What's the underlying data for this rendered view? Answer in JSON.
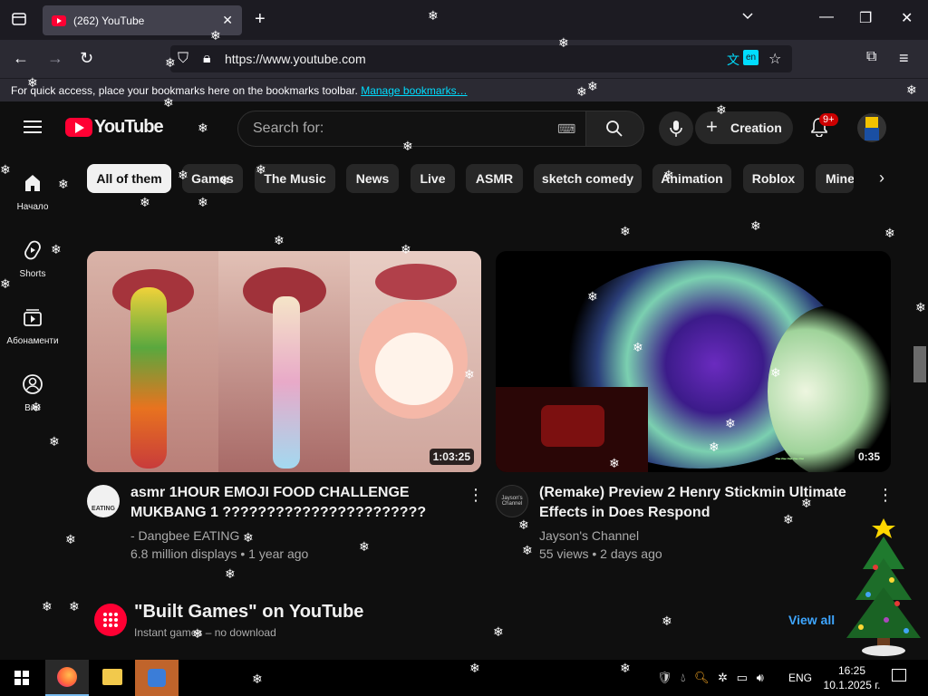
{
  "browser": {
    "tab_title": "(262) YouTube",
    "url": "https://www.youtube.com",
    "bookmarks_hint": "For quick access, place your bookmarks here on the bookmarks toolbar.",
    "bookmarks_link": "Manage bookmarks…",
    "translate_badge": "en"
  },
  "youtube": {
    "logo": "YouTube",
    "search_placeholder": "Search for:",
    "create_label": "Creation",
    "notif_count": "9+",
    "chips": [
      "All of them",
      "Games",
      "The Music",
      "News",
      "Live",
      "ASMR",
      "sketch comedy",
      "Animation",
      "Roblox",
      "Mine"
    ],
    "sidebar": [
      {
        "label": "Начало",
        "icon": "home-icon"
      },
      {
        "label": "Shorts",
        "icon": "shorts-icon"
      },
      {
        "label": "Абонаменти",
        "icon": "subscriptions-icon"
      },
      {
        "label": "Вие",
        "icon": "you-icon"
      }
    ],
    "videos": [
      {
        "title": "asmr 1HOUR EMOJI FOOD CHALLENGE MUKBANG 1 ???????????????????????",
        "channel": "- Dangbee EATING",
        "stats": "6.8 million displays • 1 year ago",
        "duration": "1:03:25",
        "avatar_text": "EATING"
      },
      {
        "title": "(Remake) Preview 2 Henry Stickmin Ultimate Effects in Does Respond",
        "channel": "Jayson's Channel",
        "stats": "55 views • 2 days ago",
        "duration": "0:35",
        "avatar_text": "Jayson's Channel"
      }
    ],
    "section": {
      "title": "\"Built Games\" on YouTube",
      "subtitle": "Instant games – no download",
      "view_all": "View all"
    }
  },
  "taskbar": {
    "language": "ENG",
    "time": "16:25",
    "date": "10.1.2025 г."
  }
}
